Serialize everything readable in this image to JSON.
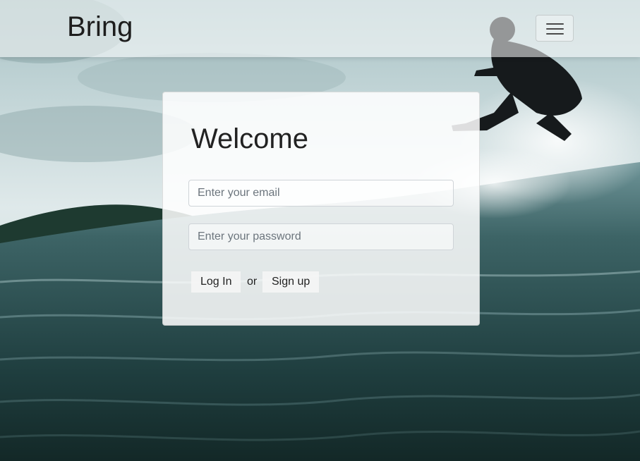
{
  "navbar": {
    "brand": "Bring",
    "toggler_icon": "hamburger-menu-icon"
  },
  "login_card": {
    "heading": "Welcome",
    "email_placeholder": "Enter your email",
    "password_placeholder": "Enter your password",
    "login_label": "Log In",
    "separator": "or",
    "signup_label": "Sign up"
  },
  "colors": {
    "sky": "#c9dbdd",
    "sea_dark": "#16302f",
    "sea_mid": "#3f6668",
    "hill": "#1e3a30"
  }
}
